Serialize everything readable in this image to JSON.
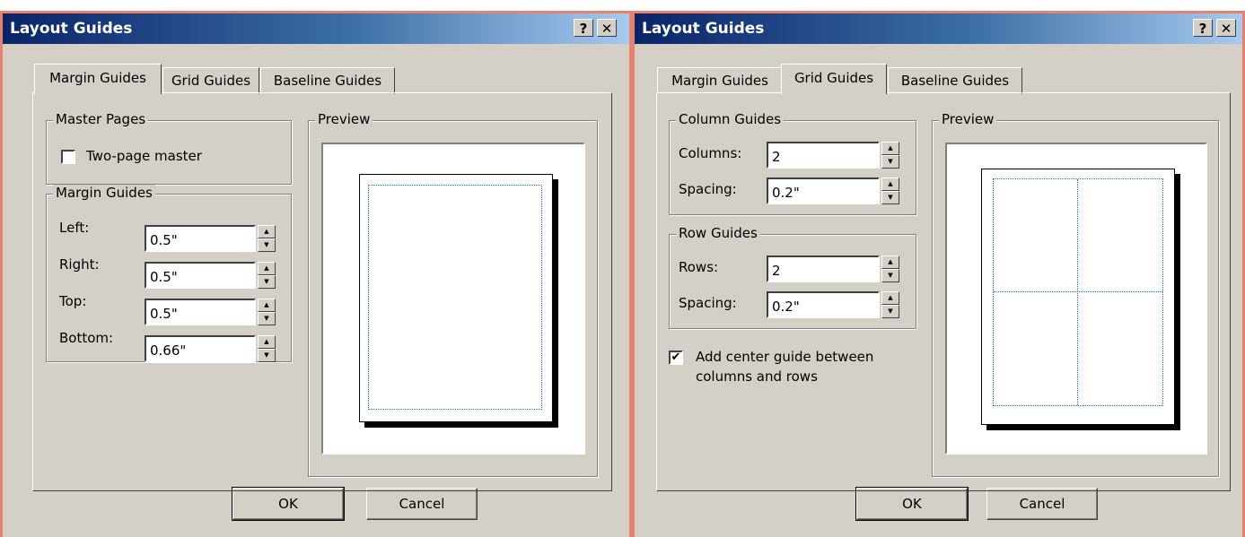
{
  "dialogs": [
    {
      "title": "Layout Guides",
      "help_label": "?",
      "close_label": "✕",
      "tabs": [
        "Margin Guides",
        "Grid Guides",
        "Baseline Guides"
      ],
      "active_tab": "Margin Guides",
      "master_pages": {
        "legend": "Master Pages",
        "two_page_label": "Two-page master",
        "two_page_checked": false
      },
      "margin_guides": {
        "legend": "Margin Guides",
        "fields": [
          {
            "label": "Left:",
            "value": "0.5\""
          },
          {
            "label": "Right:",
            "value": "0.5\""
          },
          {
            "label": "Top:",
            "value": "0.5\""
          },
          {
            "label": "Bottom:",
            "value": "0.66\""
          }
        ]
      },
      "preview_legend": "Preview",
      "ok_label": "OK",
      "cancel_label": "Cancel"
    },
    {
      "title": "Layout Guides",
      "help_label": "?",
      "close_label": "✕",
      "tabs": [
        "Margin Guides",
        "Grid Guides",
        "Baseline Guides"
      ],
      "active_tab": "Grid Guides",
      "column_guides": {
        "legend": "Column Guides",
        "fields": [
          {
            "label": "Columns:",
            "value": "2"
          },
          {
            "label": "Spacing:",
            "value": "0.2\""
          }
        ]
      },
      "row_guides": {
        "legend": "Row Guides",
        "fields": [
          {
            "label": "Rows:",
            "value": "2"
          },
          {
            "label": "Spacing:",
            "value": "0.2\""
          }
        ]
      },
      "center_guide": {
        "label_line1": "Add center guide between",
        "label_line2": "columns and rows",
        "checked": true,
        "check_mark": "✔"
      },
      "preview_legend": "Preview",
      "ok_label": "OK",
      "cancel_label": "Cancel"
    }
  ],
  "colors": {
    "dialog_face": "#d4d0c8",
    "title_gradient_start": "#0a246a",
    "title_gradient_end": "#a6caf0",
    "window_border": "#e8826a",
    "guide_blue": "#1a6fe8"
  }
}
